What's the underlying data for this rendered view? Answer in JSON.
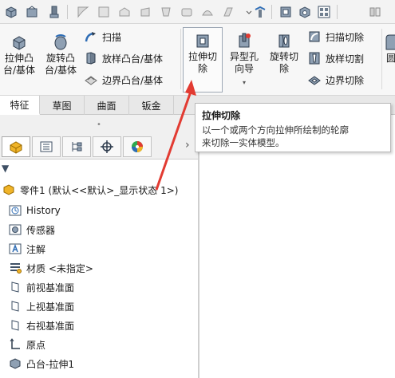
{
  "ribbon": {
    "extrude_boss": "拉伸凸\n台/基体",
    "revolve_boss": "旋转凸\n台/基体",
    "sweep": "扫描",
    "loft_boss": "放样凸台/基体",
    "boundary_boss": "边界凸台/基体",
    "extrude_cut": "拉伸切\n除",
    "hole_wizard": "异型孔\n向导",
    "revolve_cut": "旋转切\n除",
    "swept_cut": "扫描切除",
    "lofted_cut": "放样切割",
    "boundary_cut": "边界切除",
    "dropdown_arrow": "▾",
    "right_edge": "圆"
  },
  "tabs": [
    "特征",
    "草图",
    "曲面",
    "钣金"
  ],
  "tooltip": {
    "title": "拉伸切除",
    "line1": "以一个或两个方向拉伸所绘制的轮廓",
    "line2": "来切除一实体模型。"
  },
  "panel": {
    "grip": "•",
    "more": "›",
    "filter": "▼"
  },
  "tree": [
    {
      "label": "零件1 (默认<<默认>_显示状态 1>)",
      "icon": "part-icon"
    },
    {
      "label": "History",
      "icon": "history-icon"
    },
    {
      "label": "传感器",
      "icon": "sensor-icon"
    },
    {
      "label": "注解",
      "icon": "annotation-icon"
    },
    {
      "label": "材质 <未指定>",
      "icon": "material-icon"
    },
    {
      "label": "前视基准面",
      "icon": "plane-icon"
    },
    {
      "label": "上视基准面",
      "icon": "plane-icon"
    },
    {
      "label": "右视基准面",
      "icon": "plane-icon"
    },
    {
      "label": "原点",
      "icon": "origin-icon"
    },
    {
      "label": "凸台-拉伸1",
      "icon": "extrude-feature-icon"
    }
  ],
  "colors": {
    "accent_blue": "#2f6db5",
    "arrow_red": "#e23b32",
    "icon_gray": "#6f7e8f"
  }
}
